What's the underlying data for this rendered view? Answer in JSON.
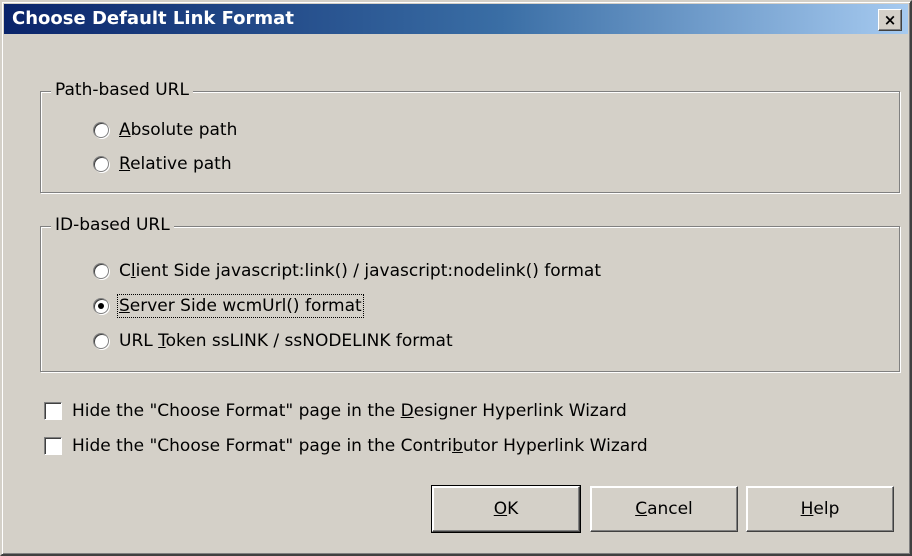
{
  "window": {
    "title": "Choose Default Link Format",
    "close_glyph": "×"
  },
  "path_group": {
    "legend": "Path-based URL",
    "options": [
      {
        "accel": "A",
        "rest": "bsolute path",
        "checked": false
      },
      {
        "accel": "R",
        "rest": "elative path",
        "checked": false
      }
    ]
  },
  "id_group": {
    "legend": "ID-based URL",
    "options": [
      {
        "pre": "C",
        "accel": "l",
        "rest": "ient Side javascript:link() / javascript:nodelink() format",
        "checked": false
      },
      {
        "pre": "",
        "accel": "S",
        "rest": "erver Side wcmUrl() format",
        "checked": true
      },
      {
        "pre": "URL ",
        "accel": "T",
        "rest": "oken ssLINK / ssNODELINK format",
        "checked": false
      }
    ]
  },
  "checkboxes": [
    {
      "pre": "Hide the \"Choose Format\" page in the ",
      "accel": "D",
      "rest": "esigner Hyperlink Wizard",
      "checked": false
    },
    {
      "pre": "Hide the \"Choose Format\" page in the Contri",
      "accel": "b",
      "rest": "utor Hyperlink Wizard",
      "checked": false
    }
  ],
  "buttons": {
    "ok": {
      "accel": "O",
      "rest": "K"
    },
    "cancel": {
      "accel": "C",
      "rest": "ancel"
    },
    "help": {
      "accel": "H",
      "rest": "elp"
    }
  }
}
